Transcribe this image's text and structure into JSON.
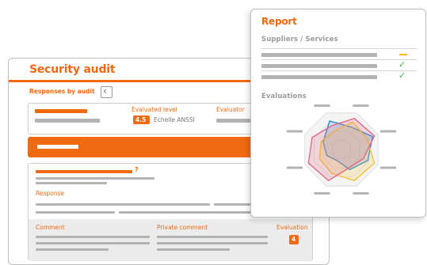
{
  "security_audit": {
    "title": "Security audit",
    "responses_by_audit": "Responses by audit",
    "back_icon": "chevron-left-icon",
    "evaluated_level_label": "Evaluated level",
    "evaluator_label": "Evaluator",
    "level_value": "4.5",
    "scale_name": "Echelle ANSSI",
    "question_mark": "?",
    "response_label": "Response",
    "comment_label": "Comment",
    "private_comment_label": "Private comment",
    "evaluation_label": "Evaluation",
    "evaluation_value": "4",
    "accent_color": "#f06a12"
  },
  "report": {
    "title": "Report",
    "suppliers_heading": "Suppliers / Services",
    "suppliers": [
      {
        "status_icon": "dash-icon",
        "status_color": "#f5b800"
      },
      {
        "status_icon": "check-icon",
        "status_color": "#4caf50"
      },
      {
        "status_icon": "check-icon",
        "status_color": "#4caf50"
      }
    ],
    "evaluations_heading": "Evaluations",
    "radar_series": [
      {
        "color": "#2f8fd6",
        "values": [
          0.62,
          0.85,
          0.72,
          0.55,
          0.3,
          0.4,
          0.5,
          0.78
        ]
      },
      {
        "color": "#f5c23d",
        "values": [
          0.75,
          0.7,
          0.9,
          0.85,
          0.65,
          0.6,
          0.55,
          0.5
        ]
      },
      {
        "color": "#e06a86",
        "values": [
          0.85,
          0.9,
          0.6,
          0.5,
          0.85,
          0.9,
          0.8,
          0.65
        ]
      }
    ]
  }
}
